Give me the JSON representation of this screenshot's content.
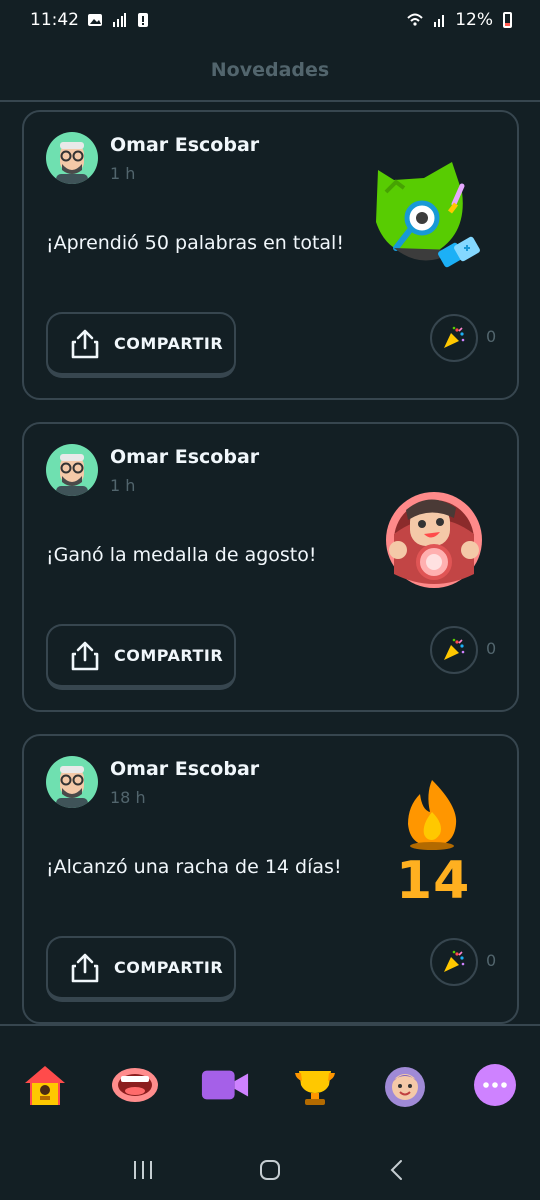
{
  "status_bar": {
    "time": "11:42",
    "battery": "12%"
  },
  "header": {
    "title": "Novedades"
  },
  "feed": [
    {
      "user": "Omar Escobar",
      "time": "1 h",
      "message": "¡Aprendió 50 palabras en total!",
      "share_label": "COMPARTIR",
      "reactions": "0",
      "illustration": "owl-studying-icon"
    },
    {
      "user": "Omar Escobar",
      "time": "1 h",
      "message": "¡Ganó la medalla de agosto!",
      "share_label": "COMPARTIR",
      "reactions": "0",
      "illustration": "monthly-medal-icon"
    },
    {
      "user": "Omar Escobar",
      "time": "18 h",
      "message": "¡Alcanzó una racha de 14 días!",
      "share_label": "COMPARTIR",
      "reactions": "0",
      "streak": "14",
      "illustration": "streak-flame-icon"
    }
  ],
  "bottom_nav": [
    "home-icon",
    "speak-icon",
    "video-icon",
    "leaderboard-trophy-icon",
    "profile-icon",
    "more-icon"
  ],
  "colors": {
    "background": "#131f24",
    "border": "#37464f",
    "muted": "#52656d",
    "streak": "#ffb020",
    "avatar": "#6fe0b0"
  }
}
